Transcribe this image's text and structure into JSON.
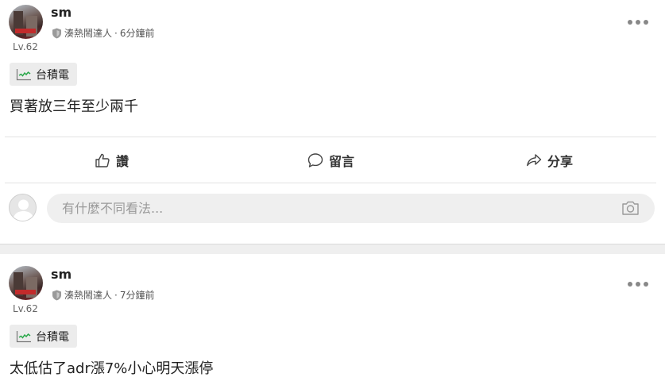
{
  "posts": [
    {
      "username": "sm",
      "badge": "湊熱鬧達人",
      "separator": "·",
      "time": "6分鐘前",
      "level": "Lv.62",
      "tag": "台積電",
      "content": "買著放三年至少兩千",
      "actions": {
        "like": "讚",
        "comment": "留言",
        "share": "分享"
      },
      "comment_placeholder": "有什麼不同看法..."
    },
    {
      "username": "sm",
      "badge": "湊熱鬧達人",
      "separator": "·",
      "time": "7分鐘前",
      "level": "Lv.62",
      "tag": "台積電",
      "content": "太低估了adr漲7%小心明天漲停"
    }
  ],
  "icons": {
    "badge": "shield-icon",
    "more": "more-dots-icon",
    "tag": "stock-chart-icon",
    "like": "thumbs-up-icon",
    "comment": "speech-bubble-icon",
    "share": "share-arrow-icon",
    "camera": "camera-icon"
  },
  "colors": {
    "chart_line": "#2aa84a",
    "tag_bg": "#ececec",
    "input_bg": "#efefef",
    "divider_band": "#efefef"
  }
}
